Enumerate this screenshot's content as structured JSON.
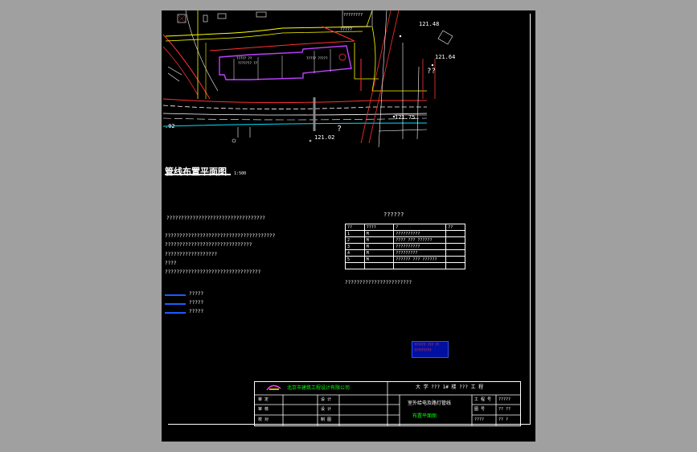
{
  "drawing": {
    "title_main": "管线布置平面图",
    "title_scale": "1:500",
    "plan_labels": {
      "elev_top_right": "121.48",
      "elev_right_mid": "121.64",
      "elev_right_low": "121.75",
      "elev_bottom": "121.02",
      "elev_left_edge": ".02",
      "road_label": "?",
      "building_note_1": "?????",
      "building_note_2": "??",
      "building_text_1": "?????  ??",
      "building_text_2": "???????  ??",
      "building_text_3": "?????  ?????",
      "top_building_label": "????????"
    },
    "notes": {
      "header": "??????????????????????????????????",
      "line1": "??????????????????????????????????????",
      "line2": "??????????????????????????????",
      "line3": "??????????????????",
      "line4": "????",
      "line5": "?????????????????????????????????"
    },
    "legend": [
      {
        "label": "?????"
      },
      {
        "label": "?????"
      },
      {
        "label": "?????"
      }
    ],
    "schedule": {
      "title": "??????",
      "headers": [
        "??",
        "????",
        "?",
        "?",
        "??"
      ],
      "rows": [
        [
          "1",
          "M",
          "??????????",
          ""
        ],
        [
          "2",
          "M",
          "????  ???  ??????",
          ""
        ],
        [
          "3",
          "M",
          "??????????",
          ""
        ],
        [
          "4",
          "M",
          "?????????",
          ""
        ],
        [
          "5",
          "M",
          "??????  ??? ??????",
          ""
        ],
        [
          "",
          "",
          "",
          ""
        ]
      ],
      "footnote": "???????????????????????"
    },
    "stamp": {
      "line1": "?????? ??? ??",
      "line2": "?????????"
    },
    "title_block": {
      "company": "北京市建筑工程设计有限公司",
      "project": "大 学 ??? 1# 楼 ??? 工 程",
      "drawing_name_1": "室外给电及路灯管线",
      "drawing_name_2": "布置平面图",
      "row1_left": "审 定",
      "row1_mid": "设 计",
      "row2_left": "审 核",
      "row2_mid": "设 计",
      "row3_left": "校 对",
      "row3_mid": "制 图",
      "right_label_1": "工 程 号",
      "right_val_1": "?????",
      "right_label_2": "图 号",
      "right_val_2": "?? ??",
      "right_label_3": "????",
      "right_val_3": "?? ?"
    }
  }
}
